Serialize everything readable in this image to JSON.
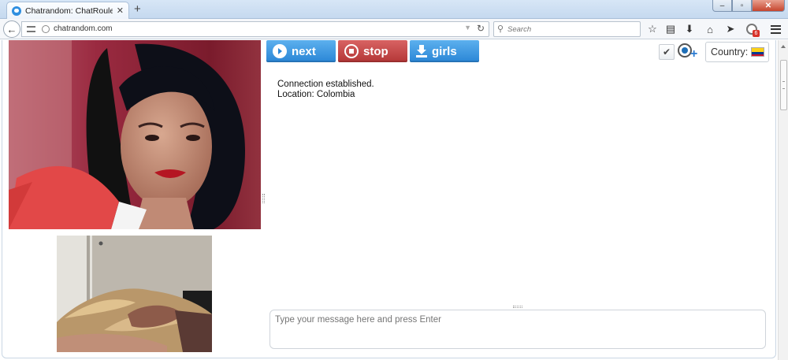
{
  "browser": {
    "tab_title": "Chatrandom: ChatRoulette...",
    "tab_close": "✕",
    "new_tab": "+",
    "url": "chatrandom.com",
    "search_placeholder": "Search",
    "window_controls": {
      "minimize": "–",
      "maximize": "▫",
      "close": "✕"
    },
    "icons": [
      "back-icon",
      "star-icon",
      "reading-list-icon",
      "download-icon",
      "home-icon",
      "send-icon",
      "extension-icon",
      "menu-icon"
    ],
    "extension_badge": "6"
  },
  "controls": {
    "next_label": "next",
    "stop_label": "stop",
    "girls_label": "girls",
    "next_color": "#2a86d6",
    "stop_color": "#b43636",
    "country_label": "Country:",
    "country_flag": "colombia-flag-icon",
    "flag_colors": [
      "#fcd116",
      "#003893",
      "#ce1126"
    ]
  },
  "chat": {
    "messages": [
      "Connection established.",
      "Location: Colombia"
    ],
    "input_placeholder": "Type your message here and press Enter"
  }
}
